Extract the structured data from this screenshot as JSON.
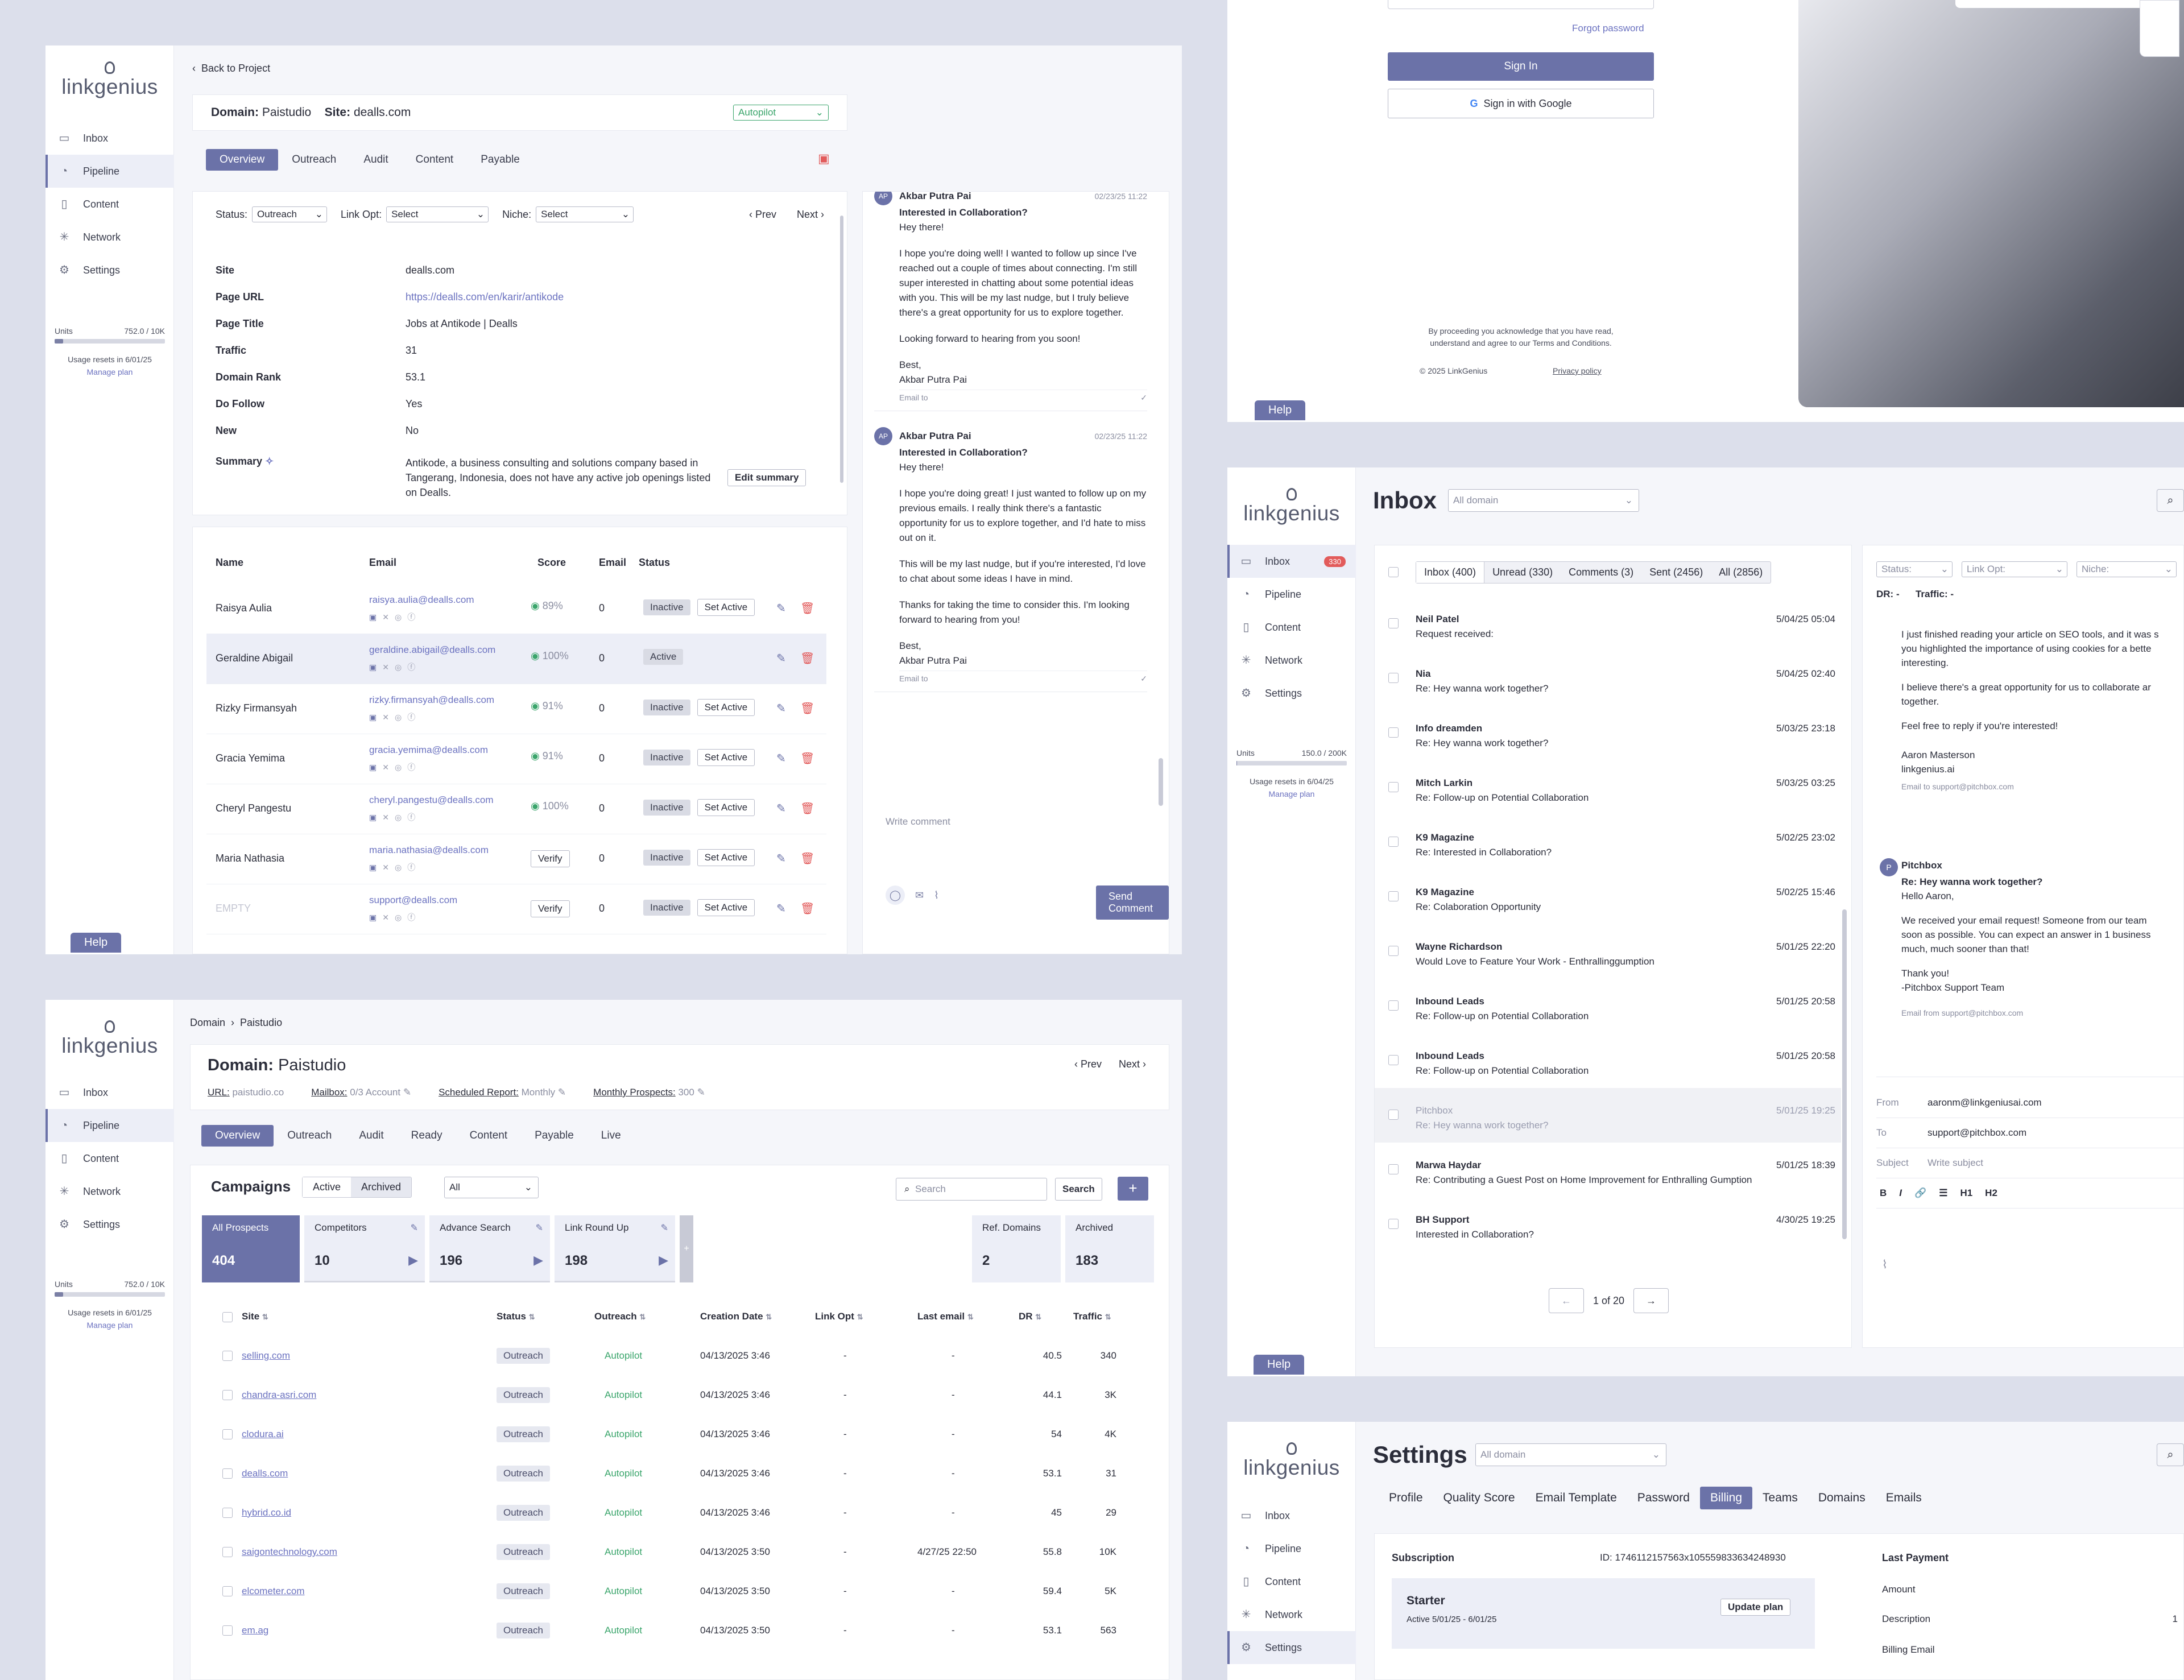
{
  "brand": "linkgenius",
  "nav": [
    {
      "label": "Inbox",
      "icon": "inbox-icon"
    },
    {
      "label": "Pipeline",
      "icon": "pipeline-icon"
    },
    {
      "label": "Content",
      "icon": "content-icon"
    },
    {
      "label": "Network",
      "icon": "network-icon"
    },
    {
      "label": "Settings",
      "icon": "settings-icon"
    }
  ],
  "help_label": "Help",
  "units_label": "Units",
  "manage_plan": "Manage plan",
  "p1": {
    "units": "752.0 / 10K",
    "units_fill": 0.0752,
    "reset": "Usage resets in 6/01/25",
    "back": "Back to Project",
    "domain_label": "Domain:",
    "domain": "Paistudio",
    "site_label": "Site:",
    "site": "dealls.com",
    "mode": "Autopilot",
    "tabs": [
      "Overview",
      "Outreach",
      "Audit",
      "Content",
      "Payable"
    ],
    "filters": {
      "status_label": "Status:",
      "status": "Outreach",
      "linkopt_label": "Link Opt:",
      "linkopt": "Select",
      "niche_label": "Niche:",
      "niche": "Select",
      "prev": "Prev",
      "next": "Next"
    },
    "details": [
      {
        "k": "Site",
        "v": "dealls.com"
      },
      {
        "k": "Page URL",
        "v": "https://dealls.com/en/karir/antikode"
      },
      {
        "k": "Page Title",
        "v": "Jobs at Antikode | Dealls"
      },
      {
        "k": "Traffic",
        "v": "31"
      },
      {
        "k": "Domain Rank",
        "v": "53.1"
      },
      {
        "k": "Do Follow",
        "v": "Yes"
      },
      {
        "k": "New",
        "v": "No"
      }
    ],
    "summary_label": "Summary",
    "summary": "Antikode, a business consulting and solutions company based in Tangerang, Indonesia, does not have any active job openings listed on Dealls.",
    "edit_summary": "Edit summary",
    "contacts_head": {
      "name": "Name",
      "email": "Email",
      "score": "Score",
      "emailcount": "Email",
      "status": "Status"
    },
    "contacts": [
      {
        "name": "Raisya Aulia",
        "email": "raisya.aulia@dealls.com",
        "score": "89%",
        "count": "0",
        "status": "Inactive",
        "action": "Set Active",
        "verify": ""
      },
      {
        "name": "Geraldine Abigail",
        "email": "geraldine.abigail@dealls.com",
        "score": "100%",
        "count": "0",
        "status": "Active",
        "action": "",
        "verify": ""
      },
      {
        "name": "Rizky Firmansyah",
        "email": "rizky.firmansyah@dealls.com",
        "score": "91%",
        "count": "0",
        "status": "Inactive",
        "action": "Set Active",
        "verify": ""
      },
      {
        "name": "Gracia Yemima",
        "email": "gracia.yemima@dealls.com",
        "score": "91%",
        "count": "0",
        "status": "Inactive",
        "action": "Set Active",
        "verify": ""
      },
      {
        "name": "Cheryl Pangestu",
        "email": "cheryl.pangestu@dealls.com",
        "score": "100%",
        "count": "0",
        "status": "Inactive",
        "action": "Set Active",
        "verify": ""
      },
      {
        "name": "Maria Nathasia",
        "email": "maria.nathasia@dealls.com",
        "score": "",
        "count": "0",
        "status": "Inactive",
        "action": "Set Active",
        "verify": "Verify"
      },
      {
        "name": "EMPTY",
        "email": "support@dealls.com",
        "score": "",
        "count": "0",
        "status": "Inactive",
        "action": "Set Active",
        "verify": "Verify"
      }
    ],
    "thread": [
      {
        "initials": "AP",
        "from": "Akbar Putra Pai",
        "date": "02/23/25 11:22",
        "subject": "Interested in Collaboration?",
        "greeting": "Hey there!",
        "paras": [
          "I hope you're doing well! I wanted to follow up since I've reached out a couple of times about connecting. I'm still super interested in chatting about some potential ideas with you. This will be my last nudge, but I truly believe there's a great opportunity for us to explore together.",
          "Looking forward to hearing from you soon!"
        ],
        "sign1": "Best,",
        "sign2": "Akbar Putra Pai",
        "emailto": "Email to"
      },
      {
        "initials": "AP",
        "from": "Akbar Putra Pai",
        "date": "02/23/25 11:22",
        "subject": "Interested in Collaboration?",
        "greeting": "Hey there!",
        "paras": [
          "I hope you're doing great! I just wanted to follow up on my previous emails. I really think there's a fantastic opportunity for us to explore together, and I'd hate to miss out on it.",
          "This will be my last nudge, but if you're interested, I'd love to chat about some ideas I have in mind.",
          "Thanks for taking the time to consider this. I'm looking forward to hearing from you!"
        ],
        "sign1": "Best,",
        "sign2": "Akbar Putra Pai",
        "emailto": "Email to"
      }
    ],
    "comment_placeholder": "Write comment",
    "send_comment": "Send Comment"
  },
  "login": {
    "forgot": "Forgot password",
    "signin": "Sign In",
    "google": "Sign in with Google",
    "legal": "By proceeding you acknowledge that you have read, understand and agree to our Terms and Conditions.",
    "copyright": "© 2025 LinkGenius",
    "privacy": "Privacy policy"
  },
  "inbox": {
    "title": "Inbox",
    "domain_select": "All domain",
    "badge": "330",
    "units": "150.0 / 200K",
    "units_fill": 0.00075,
    "reset": "Usage resets in 6/04/25",
    "tabs": [
      "Inbox (400)",
      "Unread (330)",
      "Comments (3)",
      "Sent (2456)",
      "All (2856)"
    ],
    "messages": [
      {
        "from": "Neil Patel",
        "subject": "Request received:",
        "date": "5/04/25 05:04",
        "read": false
      },
      {
        "from": "Nia",
        "subject": "Re: Hey wanna work together?",
        "date": "5/04/25 02:40",
        "read": false
      },
      {
        "from": "Info dreamden",
        "subject": "Re: Hey wanna work together?",
        "date": "5/03/25 23:18",
        "read": false
      },
      {
        "from": "Mitch Larkin",
        "subject": "Re: Follow-up on Potential Collaboration",
        "date": "5/03/25 03:25",
        "read": false
      },
      {
        "from": "K9 Magazine",
        "subject": "Re: Interested in Collaboration?",
        "date": "5/02/25 23:02",
        "read": false
      },
      {
        "from": "K9 Magazine",
        "subject": "Re: Colaboration Opportunity",
        "date": "5/02/25 15:46",
        "read": false
      },
      {
        "from": "Wayne Richardson",
        "subject": "Would Love to Feature Your Work - Enthrallinggumption",
        "date": "5/01/25 22:20",
        "read": false
      },
      {
        "from": "Inbound Leads",
        "subject": "Re: Follow-up on Potential Collaboration",
        "date": "5/01/25 20:58",
        "read": false
      },
      {
        "from": "Inbound Leads",
        "subject": "Re: Follow-up on Potential Collaboration",
        "date": "5/01/25 20:58",
        "read": false
      },
      {
        "from": "Pitchbox",
        "subject": "Re: Hey wanna work together?",
        "date": "5/01/25 19:25",
        "read": true
      },
      {
        "from": "Marwa Haydar",
        "subject": "Re: Contributing a Guest Post on Home Improvement for Enthralling Gumption",
        "date": "5/01/25 18:39",
        "read": false
      },
      {
        "from": "BH Support",
        "subject": "Interested in Collaboration?",
        "date": "4/30/25 19:25",
        "read": false
      }
    ],
    "pager": "1 of 20",
    "detail": {
      "status": "Status:",
      "linkopt": "Link Opt:",
      "niche": "Niche:",
      "dr": "DR: -",
      "traffic": "Traffic: -",
      "body1": [
        "I just finished reading your article on SEO tools, and it was s",
        "you highlighted the importance of using cookies for a bette",
        "interesting."
      ],
      "body2": [
        "I believe there's a great opportunity for us to collaborate ar",
        "together."
      ],
      "body3": "Feel free to reply if you're interested!",
      "sig1": "Aaron Masterson",
      "sig2": "linkgenius.ai",
      "emailto1": "Email to support@pitchbox.com",
      "reply_from": "Pitchbox",
      "reply_initial": "P",
      "reply_subject": "Re: Hey wanna work together?",
      "reply_greet": "Hello Aaron,",
      "reply_body": [
        "We received your email request! Someone from our team",
        "soon as possible. You can expect an answer in 1 business",
        "much, much sooner than that!"
      ],
      "reply_thanks": "Thank you!",
      "reply_team": "-Pitchbox Support Team",
      "emailfrom": "Email from support@pitchbox.com",
      "from_label": "From",
      "from_value": "aaronm@linkgeniusai.com",
      "to_label": "To",
      "to_value": "support@pitchbox.com",
      "subject_label": "Subject",
      "subject_placeholder": "Write subject",
      "fmt": [
        "B",
        "I",
        "🔗",
        "☰",
        "H1",
        "H2"
      ]
    }
  },
  "p4": {
    "units": "752.0 / 10K",
    "units_fill": 0.0752,
    "reset": "Usage resets in 6/01/25",
    "crumb1": "Domain",
    "crumb2": "Paistudio",
    "domain_label": "Domain:",
    "domain": "Paistudio",
    "url_label": "URL:",
    "url": "paistudio.co",
    "mailbox_label": "Mailbox:",
    "mailbox": "0/3 Account",
    "report_label": "Scheduled Report:",
    "report": "Monthly",
    "prospects_label": "Monthly Prospects:",
    "prospects": "300",
    "prev": "Prev",
    "next": "Next",
    "tabs": [
      "Overview",
      "Outreach",
      "Audit",
      "Ready",
      "Content",
      "Payable",
      "Live"
    ],
    "campaigns": "Campaigns",
    "seg": [
      "Active",
      "Archived"
    ],
    "filter": "All",
    "search_placeholder": "Search",
    "search_btn": "Search",
    "add": "+",
    "stats": [
      {
        "label": "All Prospects",
        "value": "404"
      },
      {
        "label": "Competitors",
        "value": "10"
      },
      {
        "label": "Advance Search",
        "value": "196"
      },
      {
        "label": "Link Round Up",
        "value": "198"
      }
    ],
    "stats2": [
      {
        "label": "Ref. Domains",
        "value": "2"
      },
      {
        "label": "Archived",
        "value": "183"
      }
    ],
    "cols": [
      "Site",
      "Status",
      "Outreach",
      "Creation Date",
      "Link Opt",
      "Last email",
      "DR",
      "Traffic"
    ],
    "rows": [
      {
        "site": "selling.com",
        "status": "Outreach",
        "outreach": "Autopilot",
        "date": "04/13/2025 3:46",
        "linkopt": "-",
        "last": "-",
        "dr": "40.5",
        "traffic": "340"
      },
      {
        "site": "chandra-asri.com",
        "status": "Outreach",
        "outreach": "Autopilot",
        "date": "04/13/2025 3:46",
        "linkopt": "-",
        "last": "-",
        "dr": "44.1",
        "traffic": "3K"
      },
      {
        "site": "clodura.ai",
        "status": "Outreach",
        "outreach": "Autopilot",
        "date": "04/13/2025 3:46",
        "linkopt": "-",
        "last": "-",
        "dr": "54",
        "traffic": "4K"
      },
      {
        "site": "dealls.com",
        "status": "Outreach",
        "outreach": "Autopilot",
        "date": "04/13/2025 3:46",
        "linkopt": "-",
        "last": "-",
        "dr": "53.1",
        "traffic": "31"
      },
      {
        "site": "hybrid.co.id",
        "status": "Outreach",
        "outreach": "Autopilot",
        "date": "04/13/2025 3:46",
        "linkopt": "-",
        "last": "-",
        "dr": "45",
        "traffic": "29"
      },
      {
        "site": "saigontechnology.com",
        "status": "Outreach",
        "outreach": "Autopilot",
        "date": "04/13/2025 3:50",
        "linkopt": "-",
        "last": "4/27/25 22:50",
        "dr": "55.8",
        "traffic": "10K"
      },
      {
        "site": "elcometer.com",
        "status": "Outreach",
        "outreach": "Autopilot",
        "date": "04/13/2025 3:50",
        "linkopt": "-",
        "last": "-",
        "dr": "59.4",
        "traffic": "5K"
      },
      {
        "site": "em.ag",
        "status": "Outreach",
        "outreach": "Autopilot",
        "date": "04/13/2025 3:50",
        "linkopt": "-",
        "last": "-",
        "dr": "53.1",
        "traffic": "563"
      }
    ]
  },
  "settings": {
    "title": "Settings",
    "domain_select": "All domain",
    "tabs": [
      "Profile",
      "Quality Score",
      "Email Template",
      "Password",
      "Billing",
      "Teams",
      "Domains",
      "Emails"
    ],
    "subscription": "Subscription",
    "sub_id": "ID: 1746112157563x105559833634248930",
    "plan": "Starter",
    "plan_dates": "Active 5/01/25 - 6/01/25",
    "update": "Update plan",
    "last_payment": "Last Payment",
    "amount": "Amount",
    "description": "Description",
    "desc_val": "1",
    "billing_email": "Billing Email"
  }
}
